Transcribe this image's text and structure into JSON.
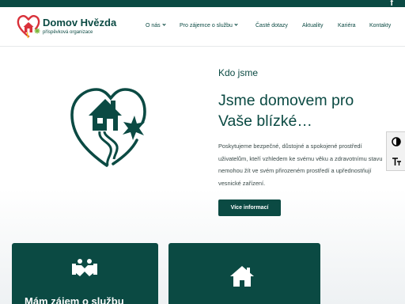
{
  "social": {
    "facebook_glyph": "f"
  },
  "brand": {
    "name": "Domov Hvězda",
    "subtitle": "příspěvková organizace"
  },
  "nav": {
    "items": [
      {
        "label": "O nás",
        "has_dropdown": true
      },
      {
        "label": "Pro zájemce o službu",
        "has_dropdown": true
      },
      {
        "label": "Časté dotazy",
        "has_dropdown": false
      },
      {
        "label": "Aktuality",
        "has_dropdown": false
      },
      {
        "label": "Kariéra",
        "has_dropdown": false
      },
      {
        "label": "Kontakty",
        "has_dropdown": false
      }
    ]
  },
  "hero": {
    "eyebrow": "Kdo jsme",
    "headline": "Jsme domovem pro Vaše blízké…",
    "description": "Poskytujeme bezpečné, důstojné a spokojené prostředí uživatelům, kteří vzhledem ke svému věku a zdravotnímu stavu nemohou žít ve svém přirozeném prostředí a upřednostňují vesnické zařízení.",
    "button_label": "Více informací"
  },
  "accessibility": {
    "contrast_icon": "contrast-icon",
    "font_icon": "text-size-icon"
  },
  "cards": [
    {
      "title": "Mám zájem o službu",
      "icon": "handshake-icon"
    },
    {
      "title": "",
      "icon": "home-icon"
    }
  ],
  "colors": {
    "primary": "#0b4a43",
    "brand_red": "#d9313a",
    "brand_green": "#7bb63a",
    "brand_yellow": "#f3c318"
  }
}
